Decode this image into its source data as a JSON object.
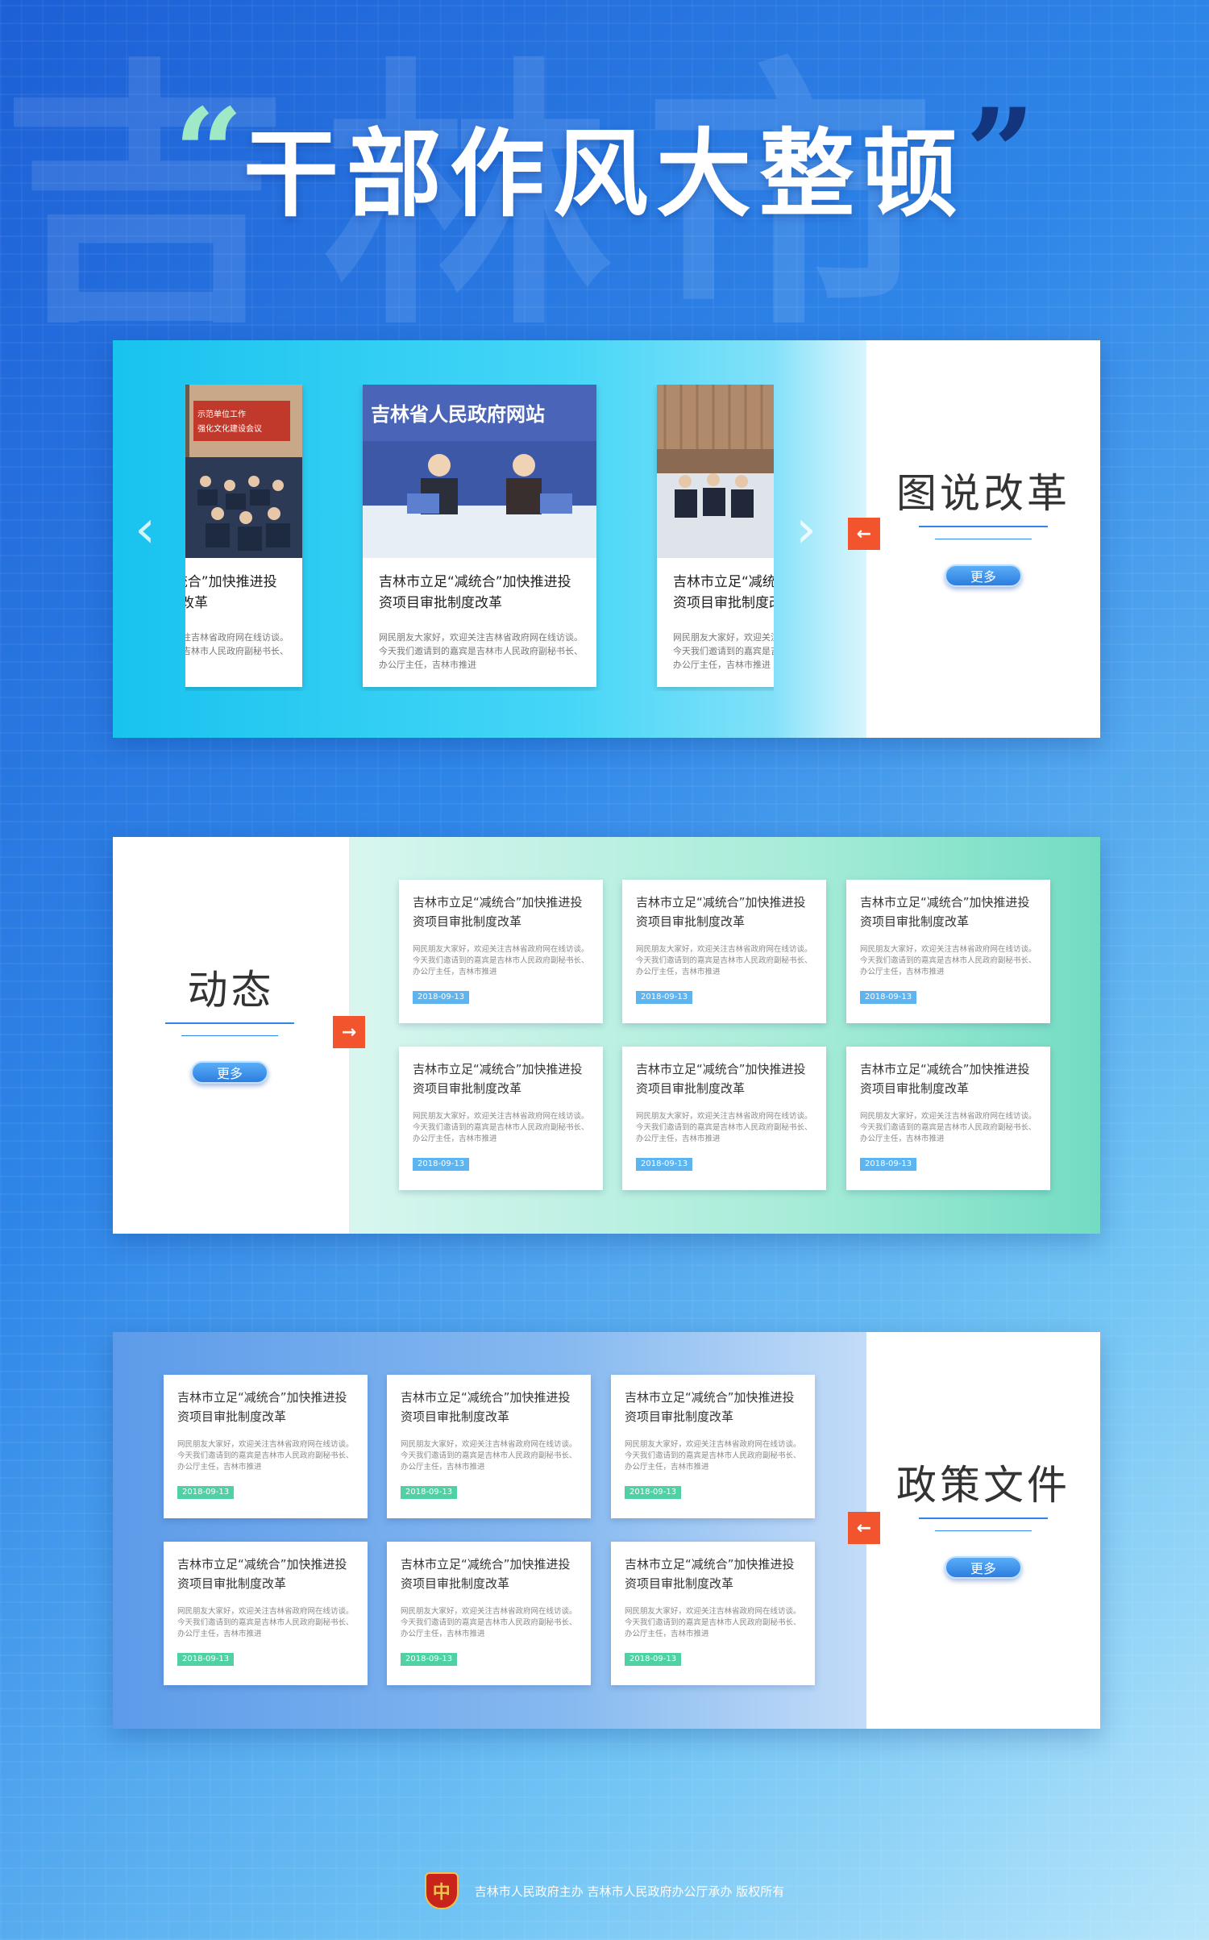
{
  "background": {
    "watermark": "吉林市"
  },
  "header": {
    "quote_open": "“",
    "title": "干部作风大整顿",
    "quote_close": "”"
  },
  "section1": {
    "title": "图说改革",
    "more": "更多",
    "arrow": "←",
    "prev": "‹",
    "next": "›",
    "photo_cards": [
      {
        "headline": "吉林市立足“减统合”加快推进投资项目审批制度改革",
        "excerpt": "网民朋友大家好，欢迎关注吉林省政府网在线访谈。今天我们邀请到的嘉宾是吉林市人民政府副秘书长、办公厅主任，吉林市推进",
        "photo_caption": ""
      },
      {
        "headline": "吉林市立足“减统合”加快推进投资项目审批制度改革",
        "excerpt": "网民朋友大家好，欢迎关注吉林省政府网在线访谈。今天我们邀请到的嘉宾是吉林市人民政府副秘书长、办公厅主任，吉林市推进",
        "photo_caption": "吉林省人民政府网站"
      },
      {
        "headline": "吉林市立足“减统合”加快推进投资项目审批制度改革",
        "excerpt": "网民朋友大家好，欢迎关注吉林省政府网在线访谈。今天我们邀请到的嘉宾是吉林市人民政府副秘书长、办公厅主任，吉林市推进",
        "photo_caption": ""
      }
    ]
  },
  "section2": {
    "title": "动态",
    "more": "更多",
    "arrow": "→",
    "cards": [
      {
        "headline": "吉林市立足“减统合”加快推进投资项目审批制度改革",
        "excerpt": "网民朋友大家好，欢迎关注吉林省政府网在线访谈。今天我们邀请到的嘉宾是吉林市人民政府副秘书长、办公厅主任，吉林市推进",
        "date": "2018-09-13"
      },
      {
        "headline": "吉林市立足“减统合”加快推进投资项目审批制度改革",
        "excerpt": "网民朋友大家好，欢迎关注吉林省政府网在线访谈。今天我们邀请到的嘉宾是吉林市人民政府副秘书长、办公厅主任，吉林市推进",
        "date": "2018-09-13"
      },
      {
        "headline": "吉林市立足“减统合”加快推进投资项目审批制度改革",
        "excerpt": "网民朋友大家好，欢迎关注吉林省政府网在线访谈。今天我们邀请到的嘉宾是吉林市人民政府副秘书长、办公厅主任，吉林市推进",
        "date": "2018-09-13"
      },
      {
        "headline": "吉林市立足“减统合”加快推进投资项目审批制度改革",
        "excerpt": "网民朋友大家好，欢迎关注吉林省政府网在线访谈。今天我们邀请到的嘉宾是吉林市人民政府副秘书长、办公厅主任，吉林市推进",
        "date": "2018-09-13"
      },
      {
        "headline": "吉林市立足“减统合”加快推进投资项目审批制度改革",
        "excerpt": "网民朋友大家好，欢迎关注吉林省政府网在线访谈。今天我们邀请到的嘉宾是吉林市人民政府副秘书长、办公厅主任，吉林市推进",
        "date": "2018-09-13"
      },
      {
        "headline": "吉林市立足“减统合”加快推进投资项目审批制度改革",
        "excerpt": "网民朋友大家好，欢迎关注吉林省政府网在线访谈。今天我们邀请到的嘉宾是吉林市人民政府副秘书长、办公厅主任，吉林市推进",
        "date": "2018-09-13"
      }
    ]
  },
  "section3": {
    "title": "政策文件",
    "more": "更多",
    "arrow": "←",
    "cards": [
      {
        "headline": "吉林市立足“减统合”加快推进投资项目审批制度改革",
        "excerpt": "网民朋友大家好，欢迎关注吉林省政府网在线访谈。今天我们邀请到的嘉宾是吉林市人民政府副秘书长、办公厅主任，吉林市推进",
        "date": "2018-09-13"
      },
      {
        "headline": "吉林市立足“减统合”加快推进投资项目审批制度改革",
        "excerpt": "网民朋友大家好，欢迎关注吉林省政府网在线访谈。今天我们邀请到的嘉宾是吉林市人民政府副秘书长、办公厅主任，吉林市推进",
        "date": "2018-09-13"
      },
      {
        "headline": "吉林市立足“减统合”加快推进投资项目审批制度改革",
        "excerpt": "网民朋友大家好，欢迎关注吉林省政府网在线访谈。今天我们邀请到的嘉宾是吉林市人民政府副秘书长、办公厅主任，吉林市推进",
        "date": "2018-09-13"
      },
      {
        "headline": "吉林市立足“减统合”加快推进投资项目审批制度改革",
        "excerpt": "网民朋友大家好，欢迎关注吉林省政府网在线访谈。今天我们邀请到的嘉宾是吉林市人民政府副秘书长、办公厅主任，吉林市推进",
        "date": "2018-09-13"
      },
      {
        "headline": "吉林市立足“减统合”加快推进投资项目审批制度改革",
        "excerpt": "网民朋友大家好，欢迎关注吉林省政府网在线访谈。今天我们邀请到的嘉宾是吉林市人民政府副秘书长、办公厅主任，吉林市推进",
        "date": "2018-09-13"
      },
      {
        "headline": "吉林市立足“减统合”加快推进投资项目审批制度改革",
        "excerpt": "网民朋友大家好，欢迎关注吉林省政府网在线访谈。今天我们邀请到的嘉宾是吉林市人民政府副秘书长、办公厅主任，吉林市推进",
        "date": "2018-09-13"
      }
    ]
  },
  "footer": {
    "emblem": "中",
    "text": "吉林市人民政府主办 吉林市人民政府办公厅承办 版权所有"
  },
  "colors": {
    "accent_blue": "#2f86e8",
    "arrow_orange": "#f2542d",
    "date_blue": "#5db4ef",
    "date_green": "#4fd1a4"
  }
}
